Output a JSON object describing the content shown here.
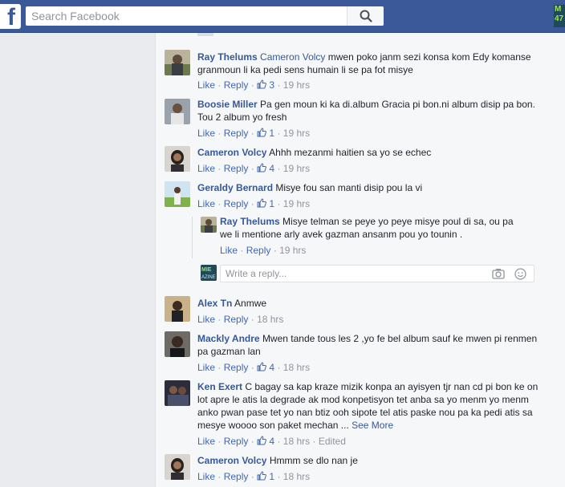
{
  "header": {
    "logo": "f",
    "search_placeholder": "Search Facebook",
    "profile_thumb_text": "M\n47"
  },
  "comments": [
    {
      "author": "Ray Thelums",
      "mention": "Cameron Volcy",
      "text": " mwen poko janm sezi konsa kom Edy komanse granmoun li ka pedi sens humain li se pa fot misye",
      "like_label": "Like",
      "reply_label": "Reply",
      "likes": "3",
      "time": "19 hrs"
    },
    {
      "author": "Boosie Miller",
      "text": "Pa gen moun ki ka di.album Gracia pi bon.ni album disip pa bon. Tou 2 album yo fresh",
      "like_label": "Like",
      "reply_label": "Reply",
      "likes": "1",
      "time": "19 hrs"
    },
    {
      "author": "Cameron Volcy",
      "text": "Ahhh mezanmi haitien sa yo se echec",
      "like_label": "Like",
      "reply_label": "Reply",
      "likes": "4",
      "time": "19 hrs"
    },
    {
      "author": "Geraldy Bernard",
      "text": "Misye fou san manti disip pou la vi",
      "like_label": "Like",
      "reply_label": "Reply",
      "likes": "1",
      "time": "19 hrs"
    },
    {
      "author": "Alex Tn",
      "text": "Anmwe",
      "like_label": "Like",
      "reply_label": "Reply",
      "time": "18 hrs"
    },
    {
      "author": "Mackly Andre",
      "text": "Mwen tande tous les 2 ,yo fe bel album sauf ke mwen pi renmen pa gazman lan",
      "like_label": "Like",
      "reply_label": "Reply",
      "likes": "4",
      "time": "18 hrs"
    },
    {
      "author": "Ken Exert",
      "text": "C bagay sa kap kraze mizik konpa an ayisyen tjr nan cd pi bon ke on lot apre le atis la degrade ak mod konpetisyon tet anba sa yo menm yo menm anko pwan pase tet yo nan btiz ooh sipote tel atis paske nou pa ka pedi atis sa mesye woooo son paket mechan ...",
      "see_more": "See More",
      "like_label": "Like",
      "reply_label": "Reply",
      "likes": "4",
      "time": "18 hrs",
      "edited": "Edited"
    },
    {
      "author": "Cameron Volcy",
      "text": "Hmmm se dlo nan je",
      "like_label": "Like",
      "reply_label": "Reply",
      "likes": "1",
      "time": "18 hrs"
    }
  ],
  "reply": {
    "author": "Ray Thelums",
    "text": "Misye telman se peye yo peye misye poul di sa, ou pa we li mentione arly avek gazman ansanm pou yo tounin .",
    "like_label": "Like",
    "reply_label": "Reply",
    "time": "19 hrs"
  },
  "reply_box": {
    "placeholder": "Write a reply...",
    "avatar_text": "MIE\nAZINE"
  },
  "separator": "·"
}
